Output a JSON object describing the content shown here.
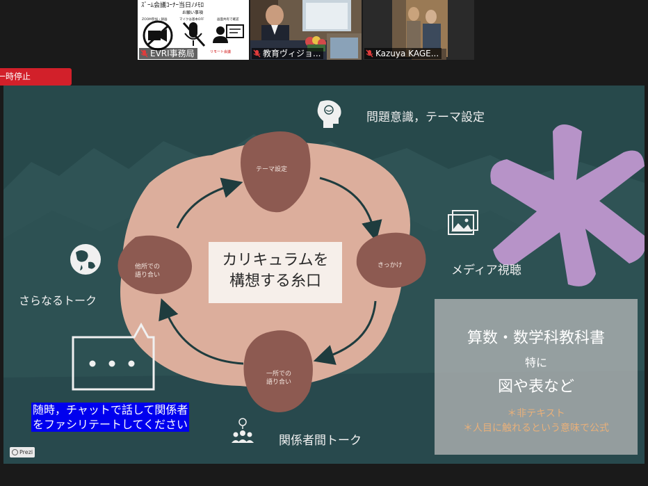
{
  "participants": [
    {
      "name": "EVRI事務局",
      "muted": true
    },
    {
      "name": "教育ヴィジョ...",
      "muted": true
    },
    {
      "name": "Kazuya KAGE...",
      "muted": true
    }
  ],
  "tile1": {
    "header_text": "ｽﾞｰﾑ会議ｺｰﾅｰ当日ﾉﾒﾓﾛ",
    "sub_header": "お願い事項",
    "labels": [
      "ZOOM参加・録画",
      "マイクは基本OFF",
      "画面共有で確認"
    ],
    "footer_text": "リモート会議"
  },
  "pause_badge": {
    "label": "一時停止"
  },
  "slide": {
    "topics": {
      "top": "問題意識，テーマ設定",
      "right": "メディア視聴",
      "left": "さらなるトーク",
      "bottom": "関係者間トーク"
    },
    "stones": {
      "top": "テーマ設定",
      "right": "きっかけ",
      "bottom_line1": "一所での",
      "bottom_line2": "語り合い",
      "left_line1": "他所での",
      "left_line2": "語り合い"
    },
    "center_line1": "カリキュラムを",
    "center_line2": "構想する糸口",
    "info_box": {
      "line1": "算数・数学科教科書",
      "line2": "特に",
      "line3": "図や表など",
      "note1": "＊非テキスト",
      "note2": "＊人目に触れるという意味で公式"
    },
    "chat_note_line1": "随時，チャットで話して関係者",
    "chat_note_line2": "をファシリテートしてください",
    "prezi_label": "Prezi"
  },
  "colors": {
    "slide_bg": "#27494b",
    "stone": "#8d5a51",
    "blob": "#dcae9c",
    "asterisk": "#b793c8",
    "arrow": "#1e3c3e",
    "note_text": "#e8b07a",
    "badge_red": "#d2202a",
    "chat_highlight": "#0000ee"
  }
}
